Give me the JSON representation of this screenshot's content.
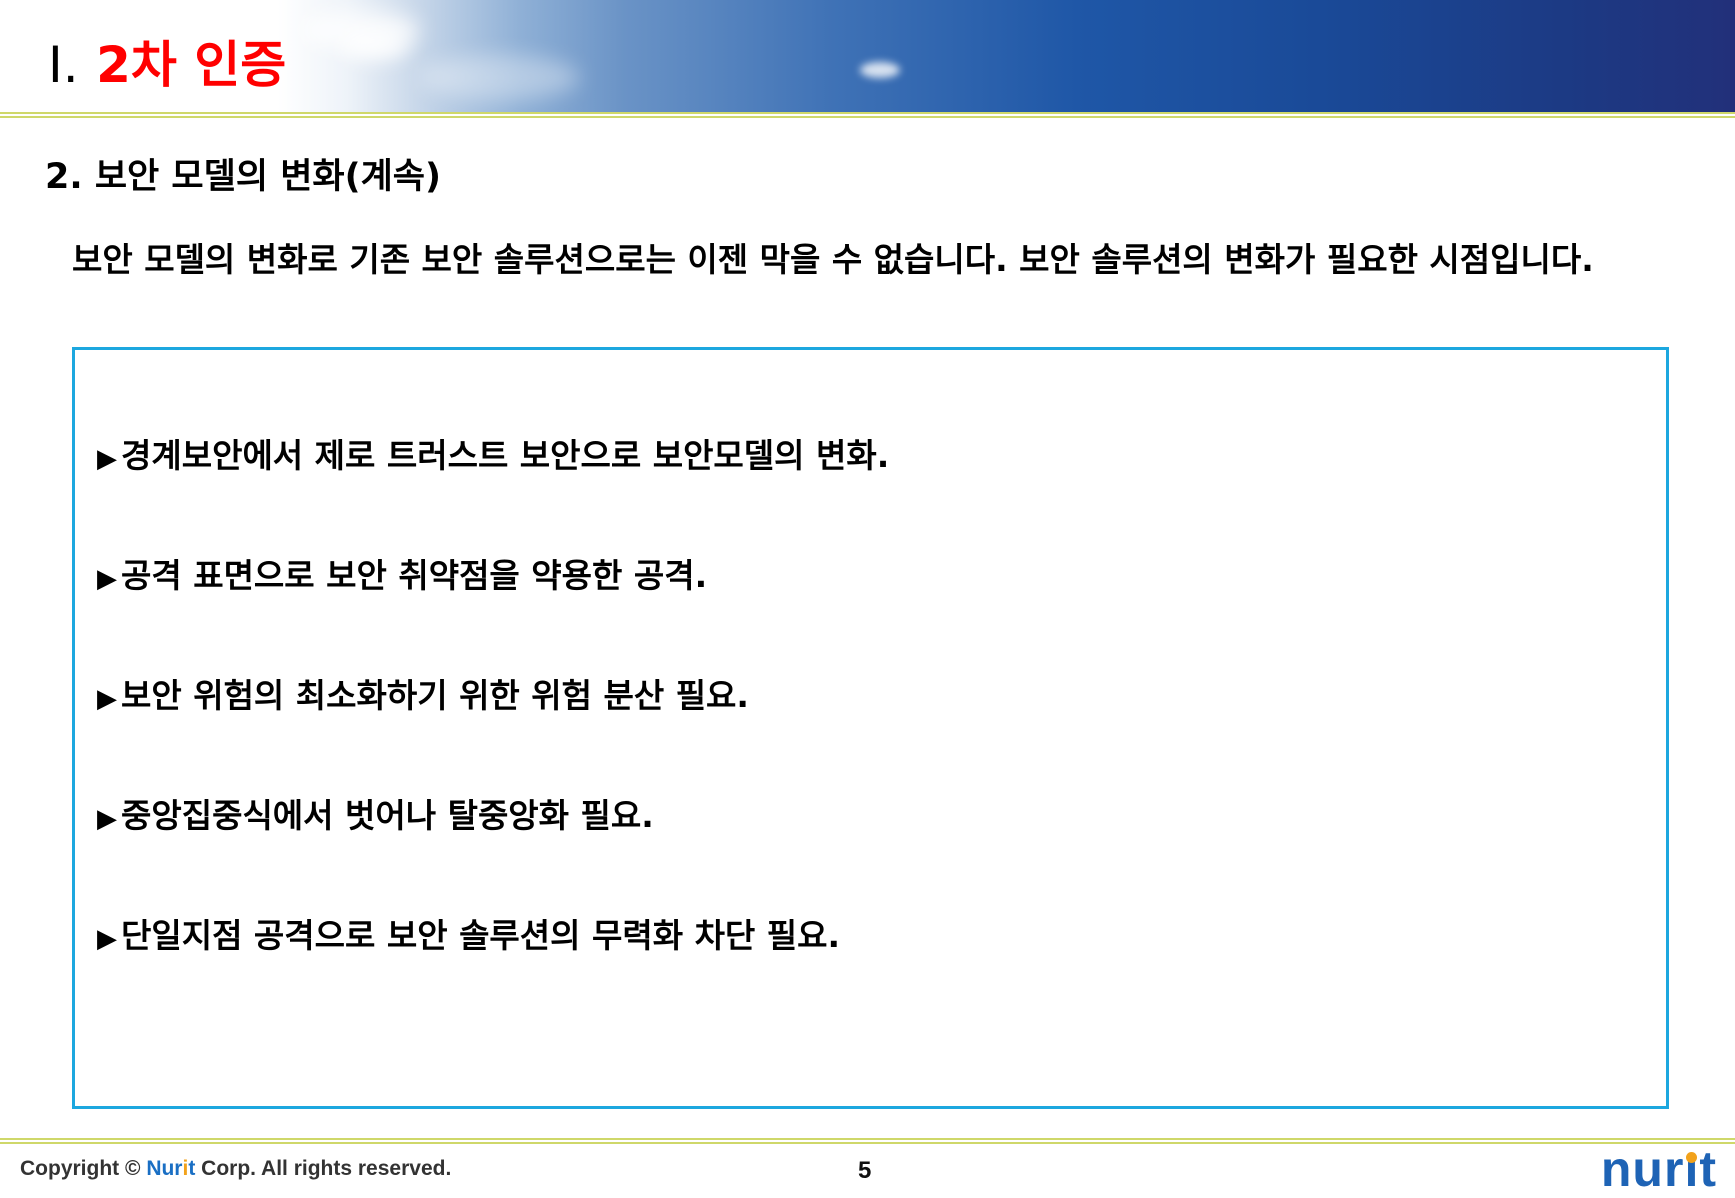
{
  "header": {
    "roman_numeral": "Ⅰ.",
    "title": "2차 인증"
  },
  "section": {
    "title": "2. 보안 모델의 변화(계속)"
  },
  "intro": {
    "text": "보안 모델의 변화로 기존 보안 솔루션으로는 이젠 막을 수 없습니다. 보안 솔루션의 변화가 필요한 시점입니다."
  },
  "bullets": [
    {
      "marker": "▶",
      "text": "경계보안에서 제로 트러스트 보안으로 보안모델의 변화."
    },
    {
      "marker": "▶",
      "text": "공격 표면으로 보안 취약점을 약용한 공격."
    },
    {
      "marker": "▶",
      "text": "보안 위험의 최소화하기 위한 위험 분산 필요."
    },
    {
      "marker": "▶",
      "text": "중앙집중식에서 벗어나 탈중앙화 필요."
    },
    {
      "marker": "▶",
      "text": "단일지점 공격으로 보안 솔루션의 무력화 차단 필요."
    }
  ],
  "footer": {
    "copyright_prefix": "Copyright © ",
    "brand_nur": "Nur",
    "brand_i": "i",
    "brand_t": "t",
    "copyright_suffix": " Corp. All rights reserved.",
    "page_number": "5",
    "logo_nur": "nur",
    "logo_i": "ı",
    "logo_t": "t"
  },
  "colors": {
    "title_red": "#ff0000",
    "box_border": "#1ca7df",
    "rule": "#cfd86a",
    "brand_blue": "#1e63b5",
    "brand_orange": "#f2a21b"
  }
}
